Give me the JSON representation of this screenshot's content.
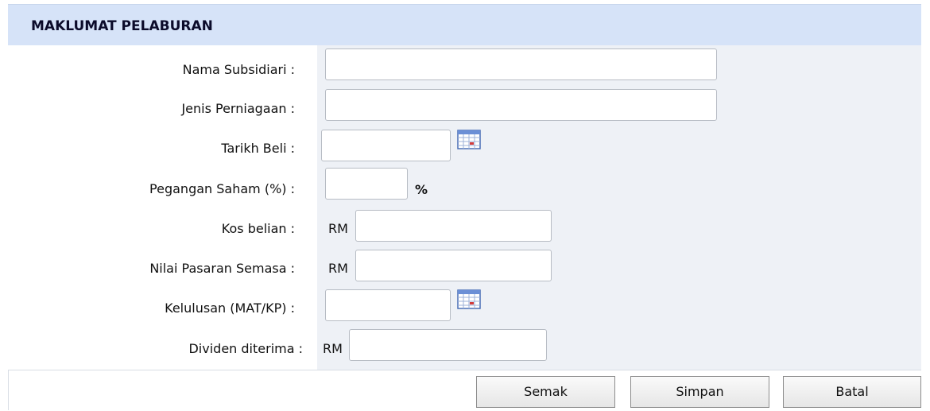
{
  "section": {
    "title": "MAKLUMAT PELABURAN"
  },
  "fields": {
    "nama_subsidiari": {
      "label": "Nama Subsidiari :",
      "value": ""
    },
    "jenis_perniagaan": {
      "label": "Jenis Perniagaan :",
      "value": ""
    },
    "tarikh_beli": {
      "label": "Tarikh Beli :",
      "value": "",
      "icon": "calendar-icon"
    },
    "pegangan_saham": {
      "label": "Pegangan Saham (%) :",
      "value": "",
      "suffix": "%"
    },
    "kos_belian": {
      "label": "Kos belian :",
      "prefix": "RM",
      "value": ""
    },
    "nilai_pasaran": {
      "label": "Nilai Pasaran Semasa :",
      "prefix": "RM",
      "value": ""
    },
    "kelulusan": {
      "label": "Kelulusan (MAT/KP) :",
      "value": "",
      "icon": "calendar-icon"
    },
    "dividen": {
      "label": "Dividen diterima :",
      "prefix": "RM",
      "value": ""
    }
  },
  "buttons": {
    "semak": "Semak",
    "simpan": "Simpan",
    "batal": "Batal"
  },
  "colors": {
    "header_bg": "#d6e3f8",
    "form_bg": "#eef1f6"
  }
}
